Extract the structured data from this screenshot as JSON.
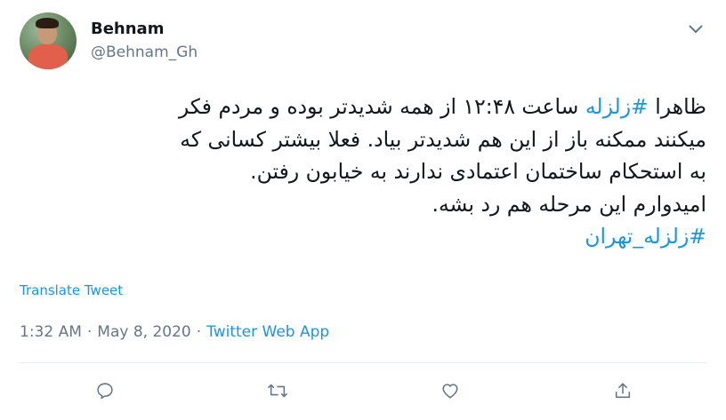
{
  "user": {
    "name": "Behnam",
    "handle": "@Behnam_Gh"
  },
  "tweet": {
    "lines": [
      {
        "before": "ظاهرا ",
        "hashtag": "#زلزله",
        "after": " ساعت ۱۲:۴۸ از همه شدیدتر بوده و مردم فکر"
      },
      {
        "text": "میکنند ممکنه باز از این هم شدیدتر بیاد. فعلا بیشتر کسانی که"
      },
      {
        "text": "به استحکام ساختمان اعتمادی ندارند به خیابون رفتن."
      },
      {
        "text": "امیدوارم این مرحله هم رد بشه."
      }
    ],
    "final_hashtag": "#زلزله_تهران"
  },
  "translate_label": "Translate Tweet",
  "meta": {
    "time": "1:32 AM",
    "separator": "·",
    "date": "May 8, 2020",
    "source": "Twitter Web App"
  },
  "icons": {
    "caret": "chevron-down-icon",
    "reply": "reply-icon",
    "retweet": "retweet-icon",
    "like": "heart-icon",
    "share": "share-icon"
  },
  "colors": {
    "accent": "#1b95e0",
    "text": "#14171a",
    "secondary": "#657786"
  }
}
